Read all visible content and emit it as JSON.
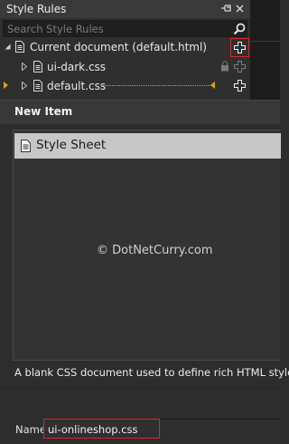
{
  "panel": {
    "title": "Style Rules",
    "search_placeholder": "Search Style Rules",
    "tree": [
      {
        "label": "Current document (default.html)"
      },
      {
        "label": "ui-dark.css"
      },
      {
        "label": "default.css"
      }
    ]
  },
  "dialog": {
    "title": "New Item",
    "items": [
      {
        "label": "Style Sheet"
      }
    ],
    "watermark": "© DotNetCurry.com",
    "description": "A blank CSS document used to define rich HTML styles.",
    "name_label": "Name",
    "name_value": "ui-onlineshop.css"
  },
  "colors": {
    "highlight_red": "#d22a2a",
    "selected_item": "#c7c7c7",
    "drag_marker": "#d9a520"
  }
}
